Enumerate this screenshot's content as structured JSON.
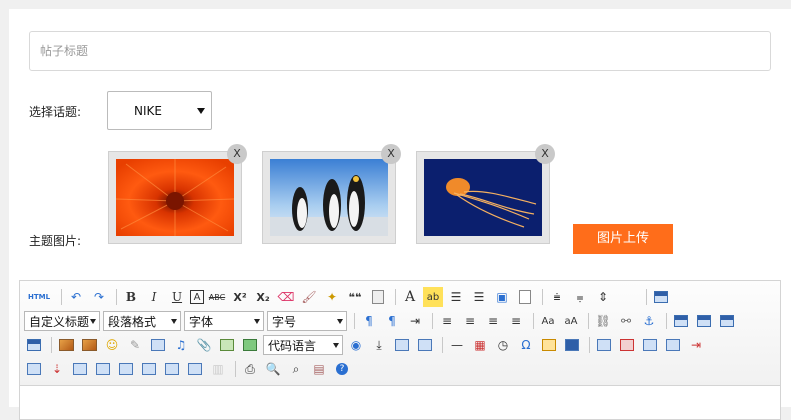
{
  "form": {
    "title_placeholder": "帖子标题",
    "topic_label": "选择话题:",
    "topic_value": "NIKE",
    "image_label": "主题图片:",
    "delete_label": "X",
    "upload_label": "图片上传"
  },
  "thumbnails": [
    {
      "subject": "chrysanthemum"
    },
    {
      "subject": "penguins"
    },
    {
      "subject": "jellyfish"
    }
  ],
  "toolbar": {
    "source_label": "HTML",
    "bold": "B",
    "italic": "I",
    "underline": "U",
    "border": "A",
    "strike": "ABC",
    "sup": "X²",
    "sub": "X₂",
    "quote": "❝❝",
    "font_color": "A",
    "highlight": "ab",
    "custom_heading": "自定义标题",
    "paragraph_format": "段落格式",
    "font_family": "字体",
    "font_size": "字号",
    "code_language": "代码语言",
    "omega": "Ω"
  },
  "colors": {
    "accent": "#ff6d1a",
    "editor_border": "#d4d4d4"
  }
}
